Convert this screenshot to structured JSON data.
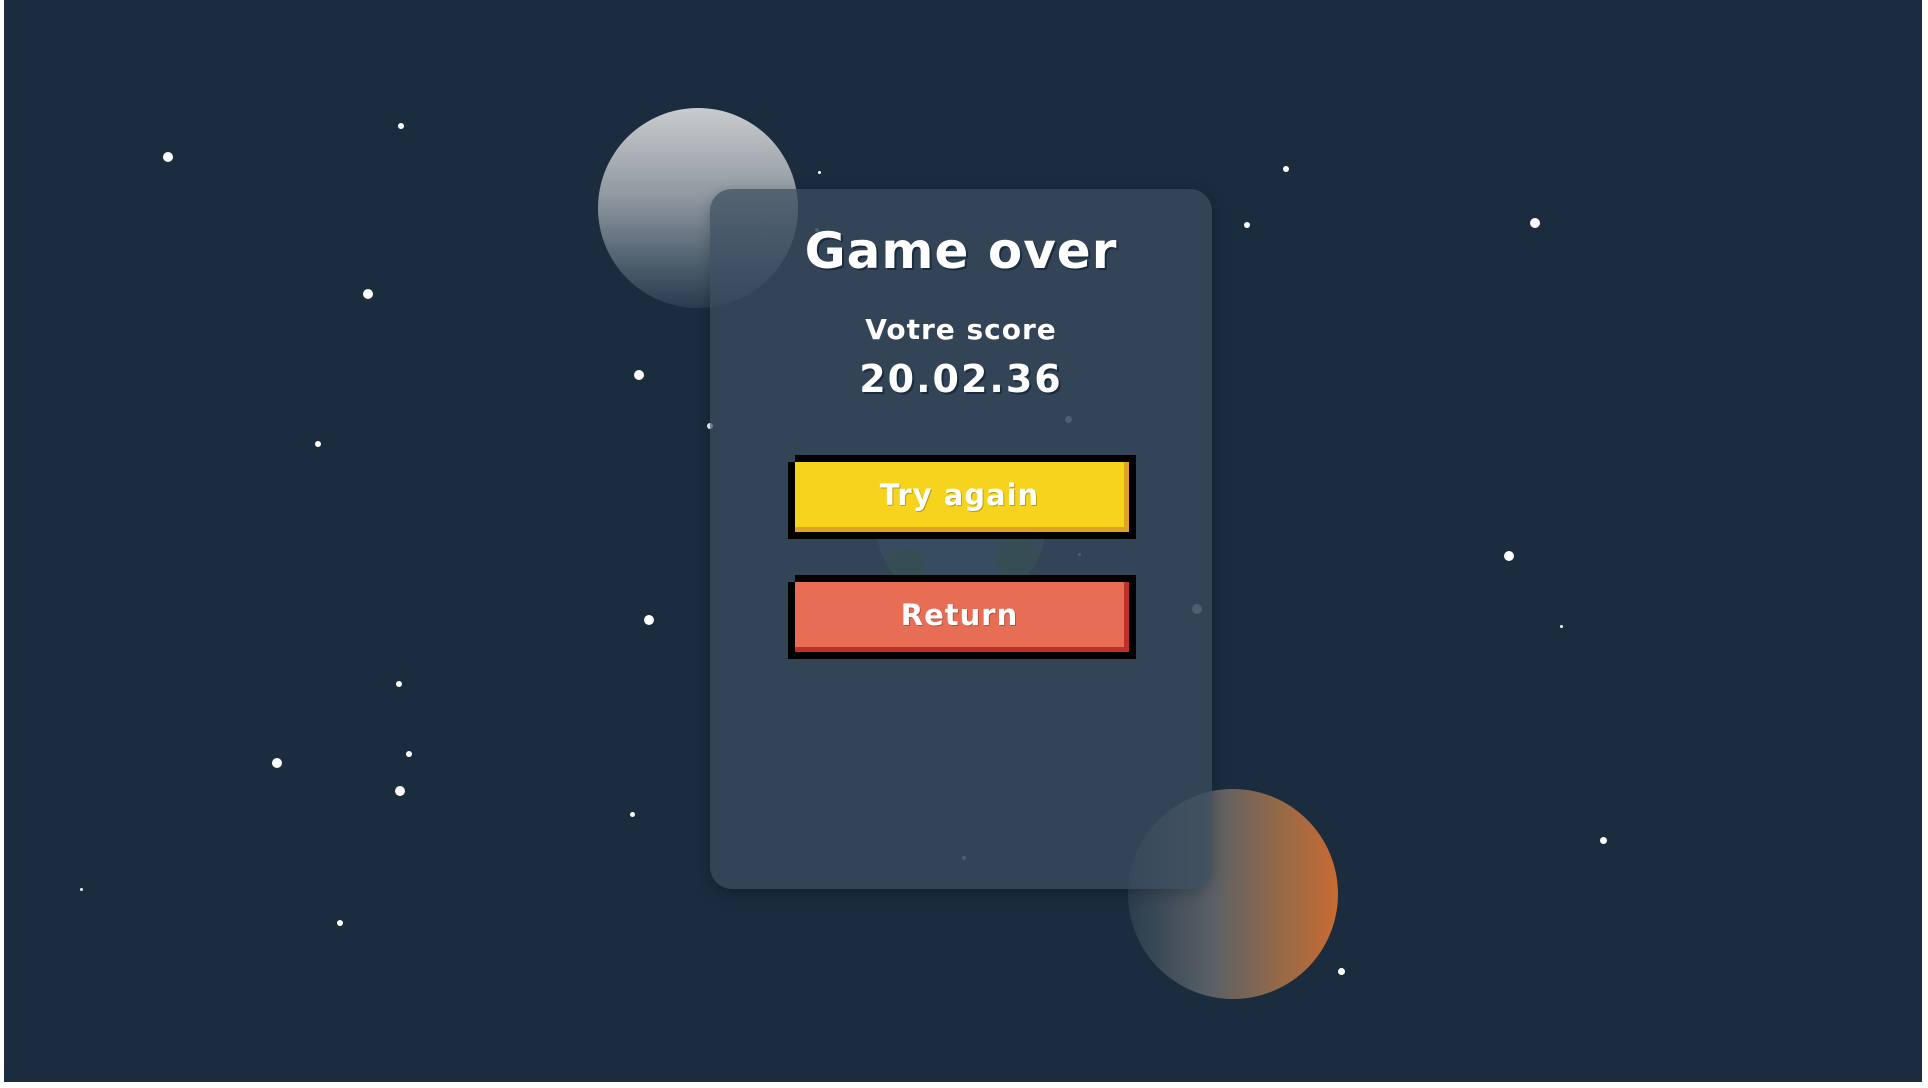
{
  "game": {
    "title": "Game over",
    "score_label": "Votre score",
    "score_value": "20.02.36"
  },
  "buttons": {
    "try_again": "Try again",
    "return": "Return"
  },
  "colors": {
    "background": "#1a2c3e",
    "card": "#3c4e5f",
    "try_again": "#f6d31c",
    "return": "#e76d55",
    "text": "#ffffff"
  },
  "decorations": [
    "moon",
    "mars-planet",
    "earth-planet",
    "stars"
  ]
}
